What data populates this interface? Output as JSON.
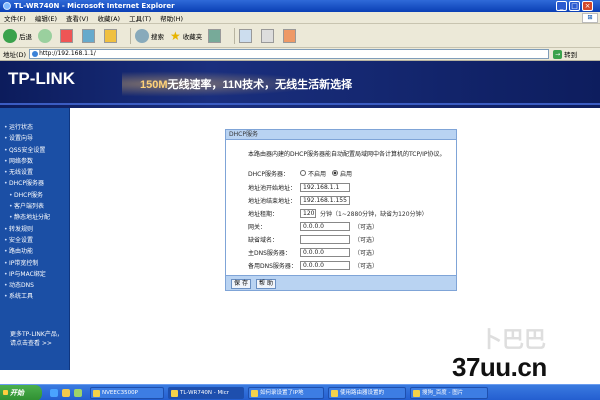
{
  "window": {
    "title": "TL-WR740N - Microsoft Internet Explorer"
  },
  "menubar": {
    "items": [
      "文件(F)",
      "编辑(E)",
      "查看(V)",
      "收藏(A)",
      "工具(T)",
      "帮助(H)"
    ]
  },
  "toolbar": {
    "back": "后退",
    "search": "搜索",
    "favorites": "收藏夹"
  },
  "addressbar": {
    "label": "地址(D)",
    "url": "http://192.168.1.1/",
    "go": "转到"
  },
  "banner": {
    "logo": "TP-LINK",
    "slogan_highlight": "150M",
    "slogan": "无线速率，11N技术，无线生活新选择"
  },
  "nav": {
    "items": [
      {
        "label": "运行状态",
        "sub": false
      },
      {
        "label": "设置向导",
        "sub": false
      },
      {
        "label": "QSS安全设置",
        "sub": false
      },
      {
        "label": "网络参数",
        "sub": false
      },
      {
        "label": "无线设置",
        "sub": false
      },
      {
        "label": "DHCP服务器",
        "sub": false
      },
      {
        "label": "DHCP服务",
        "sub": true
      },
      {
        "label": "客户端列表",
        "sub": true
      },
      {
        "label": "静态地址分配",
        "sub": true
      },
      {
        "label": "转发规则",
        "sub": false
      },
      {
        "label": "安全设置",
        "sub": false
      },
      {
        "label": "路由功能",
        "sub": false
      },
      {
        "label": "IP带宽控制",
        "sub": false
      },
      {
        "label": "IP与MAC绑定",
        "sub": false
      },
      {
        "label": "动态DNS",
        "sub": false
      },
      {
        "label": "系统工具",
        "sub": false
      }
    ],
    "more": "更多TP-LINK产品，请点击查看 >>"
  },
  "dhcp": {
    "header": "DHCP服务",
    "description": "本路由器内建的DHCP服务器能自动配置局域网中各计算机的TCP/IP协议。",
    "server_label": "DHCP服务器：",
    "option_off": "不启用",
    "option_on": "启用",
    "start_label": "地址池开始地址：",
    "start_value": "192.168.1.1",
    "end_label": "地址池结束地址：",
    "end_value": "192.168.1.155",
    "lease_label": "地址租期：",
    "lease_value": "120",
    "lease_note": "分钟（1~2880分钟，缺省为120分钟）",
    "gateway_label": "网关：",
    "gateway_value": "0.0.0.0",
    "domain_label": "缺省域名：",
    "domain_value": "",
    "dns1_label": "主DNS服务器：",
    "dns1_value": "0.0.0.0",
    "dns2_label": "备用DNS服务器：",
    "dns2_value": "0.0.0.0",
    "optional": "（可选）",
    "save": "保 存",
    "help": "帮 助"
  },
  "taskbar": {
    "start": "开始",
    "tasks": [
      "NVEEC3500P",
      "TL-WR740N - Micr",
      "如何录设置了IP地",
      "使用路由器设置的",
      "搜狗_百度 - 图片"
    ],
    "active_index": 1
  },
  "watermark": {
    "text": "37uu.cn"
  },
  "colors": {
    "nav_bg": "#1b4fa5",
    "banner_bg": "#0c1c5c",
    "panel_head": "#b9d3f2",
    "taskbar": "#245ed0"
  }
}
